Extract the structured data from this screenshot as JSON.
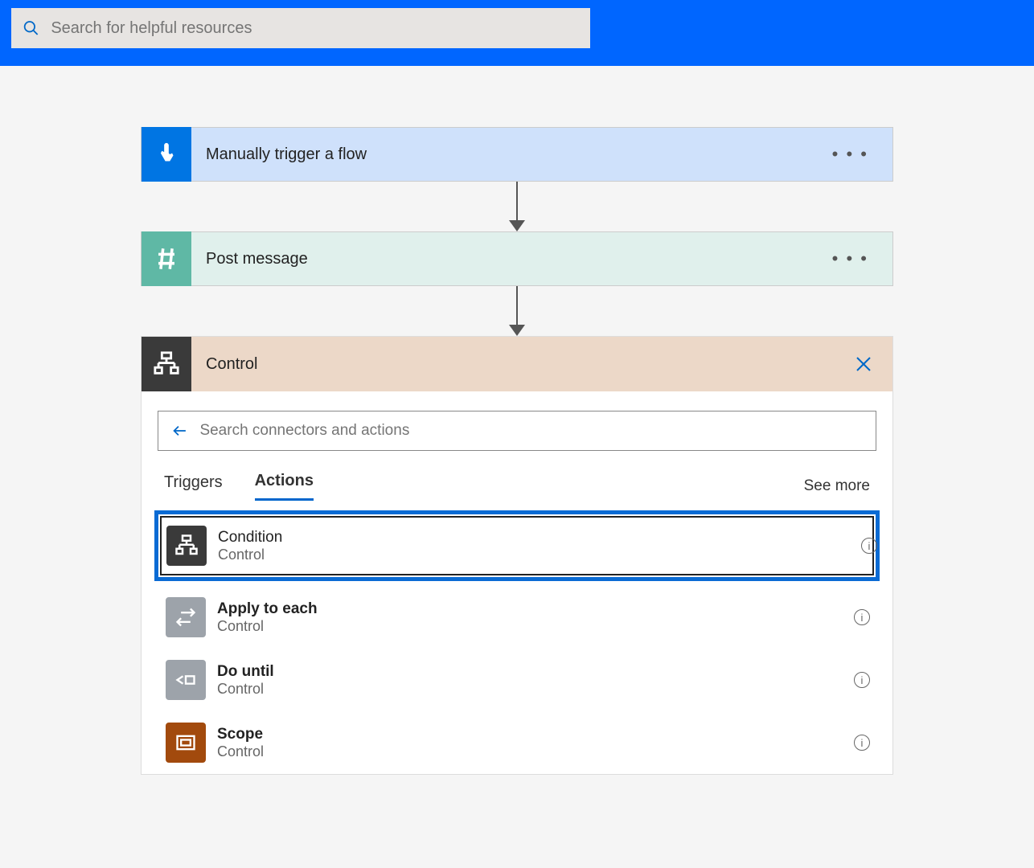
{
  "search": {
    "placeholder": "Search for helpful resources"
  },
  "steps": [
    {
      "title": "Manually trigger a flow"
    },
    {
      "title": "Post message"
    }
  ],
  "panel": {
    "title": "Control",
    "searchPlaceholder": "Search connectors and actions",
    "tabs": {
      "triggers": "Triggers",
      "actions": "Actions"
    },
    "seeMore": "See more",
    "actions": [
      {
        "name": "Condition",
        "sub": "Control"
      },
      {
        "name": "Apply to each",
        "sub": "Control"
      },
      {
        "name": "Do until",
        "sub": "Control"
      },
      {
        "name": "Scope",
        "sub": "Control"
      }
    ]
  }
}
